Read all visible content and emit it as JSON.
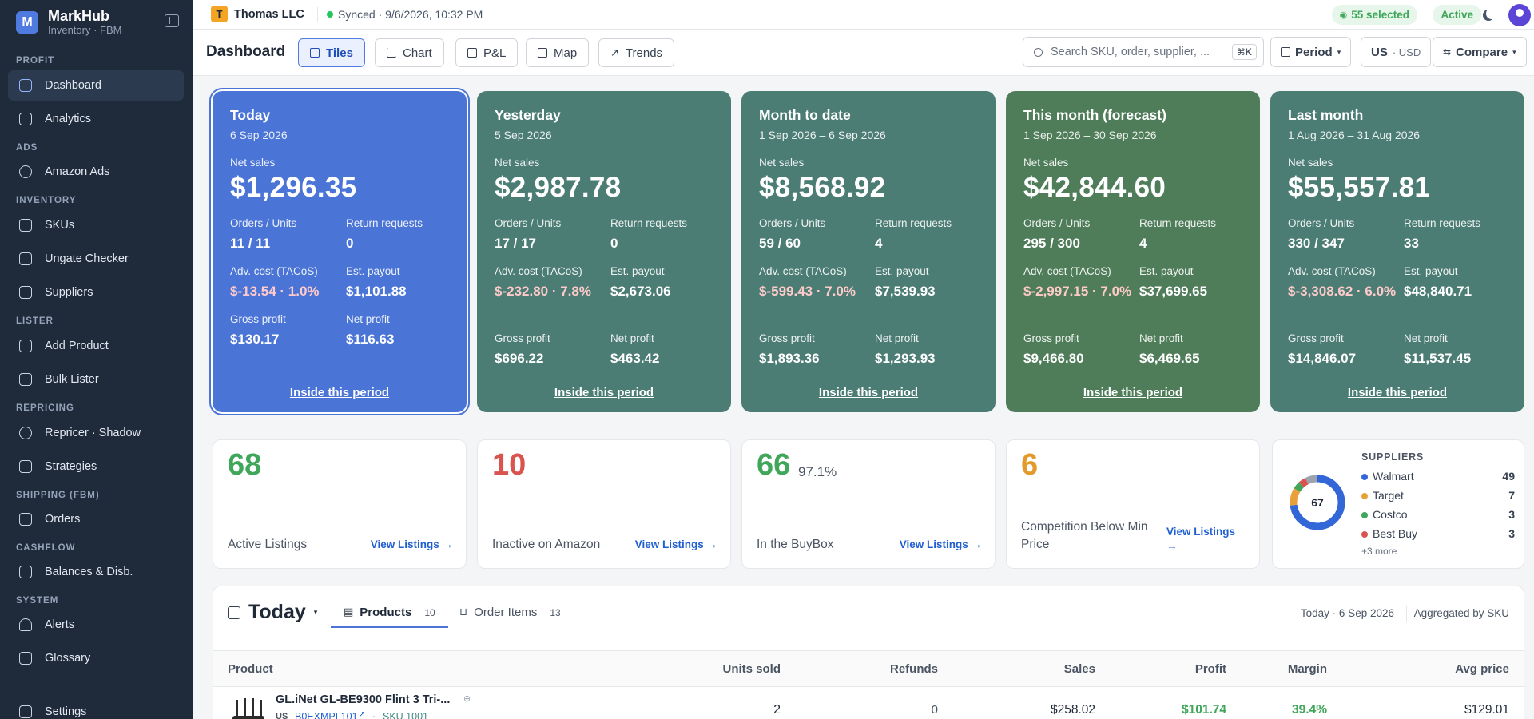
{
  "app": {
    "name": "MarkHub",
    "subtitle": "Inventory · FBM",
    "logo_letter": "M"
  },
  "sidebar": {
    "sections": [
      "PROFIT",
      "ADS",
      "INVENTORY",
      "LISTER",
      "REPRICING",
      "SHIPPING (FBM)",
      "CASHFLOW",
      "SYSTEM"
    ],
    "items": [
      "Dashboard",
      "Analytics",
      "Amazon Ads",
      "SKUs",
      "Ungate Checker",
      "Suppliers",
      "Add Product",
      "Bulk Lister",
      "Repricer · Shadow",
      "Strategies",
      "Orders",
      "Balances & Disb.",
      "Alerts",
      "Glossary",
      "Settings"
    ]
  },
  "topbar": {
    "org_letter": "T",
    "org": "Thomas LLC",
    "sync": "Synced · 9/6/2026, 10:32 PM",
    "selected": "55 selected",
    "status": "Active"
  },
  "toolbar": {
    "title": "Dashboard",
    "views": [
      "Tiles",
      "Chart",
      "P&L",
      "Map",
      "Trends"
    ],
    "search_placeholder": "Search SKU, order, supplier, ...",
    "kbd": "⌘K",
    "period": "Period",
    "market": "US",
    "currency": "· USD",
    "compare": "Compare"
  },
  "labels": {
    "net_sales": "Net sales",
    "orders_units": "Orders / Units",
    "returns": "Return requests",
    "adv": "Adv. cost (TACoS)",
    "payout": "Est. payout",
    "gross": "Gross profit",
    "net": "Net profit",
    "inside": "Inside this period"
  },
  "cards": [
    {
      "title": "Today",
      "date": "6 Sep 2026",
      "net_sales": "$1,296.35",
      "orders": "11 / 11",
      "returns": "0",
      "adv": "$-13.54 · 1.0%",
      "payout": "$1,101.88",
      "gross": "$130.17",
      "net": "$116.63",
      "color": "#4a74d6"
    },
    {
      "title": "Yesterday",
      "date": "5 Sep 2026",
      "net_sales": "$2,987.78",
      "orders": "17 / 17",
      "returns": "0",
      "adv": "$-232.80 · 7.8%",
      "payout": "$2,673.06",
      "gross": "$696.22",
      "net": "$463.42",
      "color": "#4c7d75"
    },
    {
      "title": "Month to date",
      "date": "1 Sep 2026 – 6 Sep 2026",
      "net_sales": "$8,568.92",
      "orders": "59 / 60",
      "returns": "4",
      "adv": "$-599.43 · 7.0%",
      "payout": "$7,539.93",
      "gross": "$1,893.36",
      "net": "$1,293.93",
      "color": "#4c7d75"
    },
    {
      "title": "This month (forecast)",
      "date": "1 Sep 2026 – 30 Sep 2026",
      "net_sales": "$42,844.60",
      "orders": "295 / 300",
      "returns": "4",
      "adv": "$-2,997.15 · 7.0%",
      "payout": "$37,699.65",
      "gross": "$9,466.80",
      "net": "$6,469.65",
      "color": "#4f7d5a"
    },
    {
      "title": "Last month",
      "date": "1 Aug 2026 – 31 Aug 2026",
      "net_sales": "$55,557.81",
      "orders": "330 / 347",
      "returns": "33",
      "adv": "$-3,308.62 · 6.0%",
      "payout": "$48,840.71",
      "gross": "$14,846.07",
      "net": "$11,537.45",
      "color": "#4c7d75"
    }
  ],
  "kpis": [
    {
      "value": "68",
      "label": "Active Listings",
      "link": "View Listings →",
      "color": "#3fa65a",
      "extra": ""
    },
    {
      "value": "10",
      "label": "Inactive on Amazon",
      "link": "View Listings →",
      "color": "#d9534f",
      "extra": ""
    },
    {
      "value": "66",
      "label": "In the BuyBox",
      "link": "View Listings →",
      "color": "#3fa65a",
      "extra": "97.1%"
    },
    {
      "value": "6",
      "label": "Competition Below Min Price",
      "link": "View Listings →",
      "color": "#e39a2b",
      "extra": ""
    }
  ],
  "suppliers": {
    "title": "SUPPLIERS",
    "total": "67",
    "more": "+3 more",
    "rows": [
      {
        "name": "Walmart",
        "count": "49",
        "color": "#3366d6"
      },
      {
        "name": "Target",
        "count": "7",
        "color": "#e9a03b"
      },
      {
        "name": "Costco",
        "count": "3",
        "color": "#3fa65a"
      },
      {
        "name": "Best Buy",
        "count": "3",
        "color": "#d9534f"
      }
    ]
  },
  "table": {
    "period": "Today",
    "tabs": [
      {
        "label": "Products",
        "count": "10"
      },
      {
        "label": "Order Items",
        "count": "13"
      }
    ],
    "meta": "Today · 6 Sep 2026",
    "agg": "Aggregated by SKU",
    "headers": [
      "Product",
      "Units sold",
      "Refunds",
      "Sales",
      "Profit",
      "Margin",
      "Avg price"
    ],
    "row": {
      "name": "GL.iNet GL-BE9300 Flint 3 Tri-...",
      "mkt": "US",
      "asin": "B0EXMPL101",
      "sku": "SKU 1001",
      "units": "2",
      "refunds": "0",
      "sales": "$258.02",
      "profit": "$101.74",
      "margin": "39.4%",
      "avg": "$129.01"
    }
  }
}
